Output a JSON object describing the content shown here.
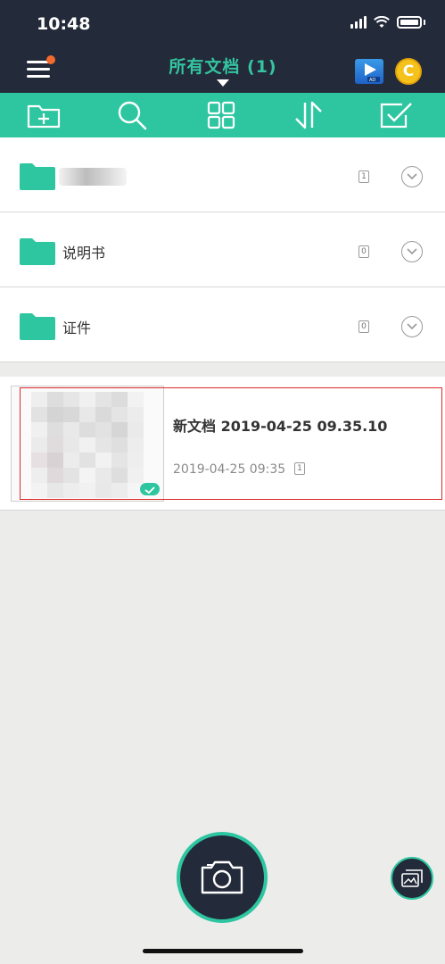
{
  "status": {
    "time": "10:48"
  },
  "header": {
    "title": "所有文档 (1)",
    "menu_icon": "hamburger-menu-icon",
    "ad_icon": "video-ad-icon",
    "coin_label": "C",
    "accent_color": "#34c4a0",
    "header_bg": "#232a3a"
  },
  "toolbar": {
    "bg_color": "#2ec6a0",
    "items": [
      {
        "name": "new-folder-icon"
      },
      {
        "name": "search-icon"
      },
      {
        "name": "grid-view-icon"
      },
      {
        "name": "sort-icon"
      },
      {
        "name": "select-icon"
      }
    ]
  },
  "folders": [
    {
      "label": "",
      "count": "1",
      "blurred": true
    },
    {
      "label": "说明书",
      "count": "0"
    },
    {
      "label": "证件",
      "count": "0"
    }
  ],
  "document": {
    "title": "新文档 2019-04-25 09.35.10",
    "date": "2019-04-25 09:35",
    "pages": "1"
  },
  "bottom": {
    "camera_icon": "camera-icon",
    "gallery_icon": "gallery-import-icon"
  }
}
